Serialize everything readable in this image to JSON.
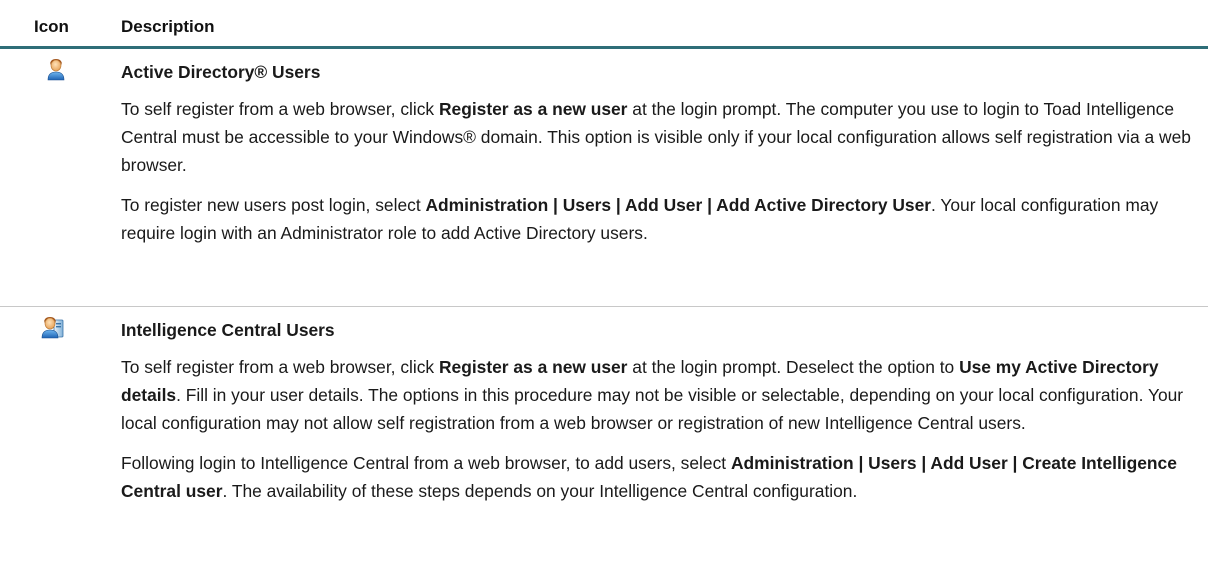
{
  "header": {
    "icon_label": "Icon",
    "description_label": "Description"
  },
  "rows": [
    {
      "icon": "active-directory-user-icon",
      "title": "Active Directory® Users",
      "paragraphs": [
        [
          {
            "t": "To self register from a web browser, click ",
            "b": false
          },
          {
            "t": "Register as a new user",
            "b": true
          },
          {
            "t": " at the login prompt. The computer you use to login to Toad Intelligence Central must be accessible to your Windows® domain. This option is visible only if your local configuration allows self registration via a web browser.",
            "b": false
          }
        ],
        [
          {
            "t": " To register new users post login, select ",
            "b": false
          },
          {
            "t": "Administration | Users | Add User | Add Active Directory User",
            "b": true
          },
          {
            "t": ". Your local configuration may require login with an Administrator role to add Active Directory users.",
            "b": false
          }
        ]
      ]
    },
    {
      "icon": "intelligence-central-user-icon",
      "title": "Intelligence Central Users",
      "paragraphs": [
        [
          {
            "t": "To self register from a web browser, click ",
            "b": false
          },
          {
            "t": "Register as a new user",
            "b": true
          },
          {
            "t": " at the login prompt. Deselect the option to ",
            "b": false
          },
          {
            "t": "Use my Active Directory details",
            "b": true
          },
          {
            "t": ". Fill in your user details. The options in this procedure may not be visible or selectable, depending on your local configuration. Your local configuration may not allow self registration from a web browser or registration of new Intelligence Central users.",
            "b": false
          }
        ],
        [
          {
            "t": "Following login to Intelligence Central from a web browser, to add users, select ",
            "b": false
          },
          {
            "t": "Administration | Users | Add User | Create Intelligence Central user",
            "b": true
          },
          {
            "t": ". The availability of these steps depends on your Intelligence Central configuration.",
            "b": false
          }
        ]
      ]
    }
  ]
}
